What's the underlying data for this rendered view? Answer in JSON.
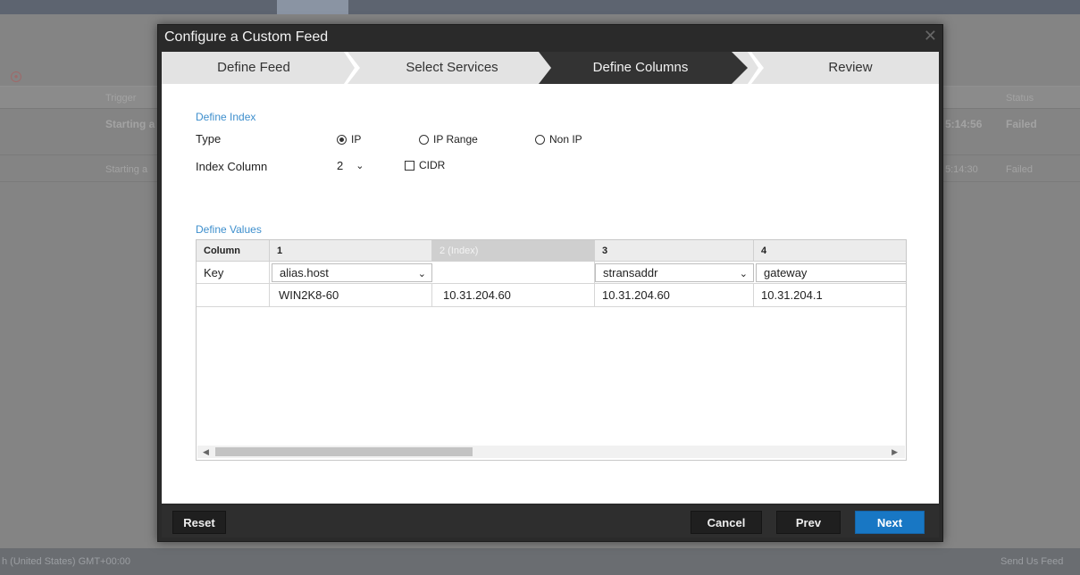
{
  "background": {
    "columns": {
      "trigger": "Trigger",
      "status": "Status"
    },
    "rows": [
      {
        "trigger": "Starting a",
        "time": "5:14:56",
        "status": "Failed"
      },
      {
        "trigger": "Starting a",
        "time": "5:14:30",
        "status": "Failed"
      }
    ],
    "footer_left": "h (United States) GMT+00:00",
    "footer_right": "Send Us Feed"
  },
  "modal": {
    "title": "Configure a Custom Feed",
    "steps": [
      {
        "label": "Define Feed",
        "active": false
      },
      {
        "label": "Select Services",
        "active": false
      },
      {
        "label": "Define Columns",
        "active": true
      },
      {
        "label": "Review",
        "active": false
      }
    ],
    "define_index": {
      "section_label": "Define Index",
      "type_label": "Type",
      "type_options": [
        "IP",
        "IP Range",
        "Non IP"
      ],
      "type_selected": "IP",
      "index_column_label": "Index Column",
      "index_column_value": "2",
      "cidr_label": "CIDR",
      "cidr_checked": false
    },
    "define_values": {
      "section_label": "Define Values",
      "headers": [
        "Column",
        "1",
        "2 (Index)",
        "3",
        "4"
      ],
      "key_row": {
        "label": "Key",
        "values": [
          "alias.host",
          "",
          "stransaddr",
          "gateway"
        ]
      },
      "data_rows": [
        [
          "",
          "WIN2K8-60",
          "10.31.204.60",
          "10.31.204.60",
          "10.31.204.1"
        ]
      ]
    },
    "buttons": {
      "reset": "Reset",
      "cancel": "Cancel",
      "prev": "Prev",
      "next": "Next"
    },
    "colors": {
      "accent": "#1877c4",
      "section_label": "#3e8fcd",
      "active_step": "#333333"
    }
  }
}
